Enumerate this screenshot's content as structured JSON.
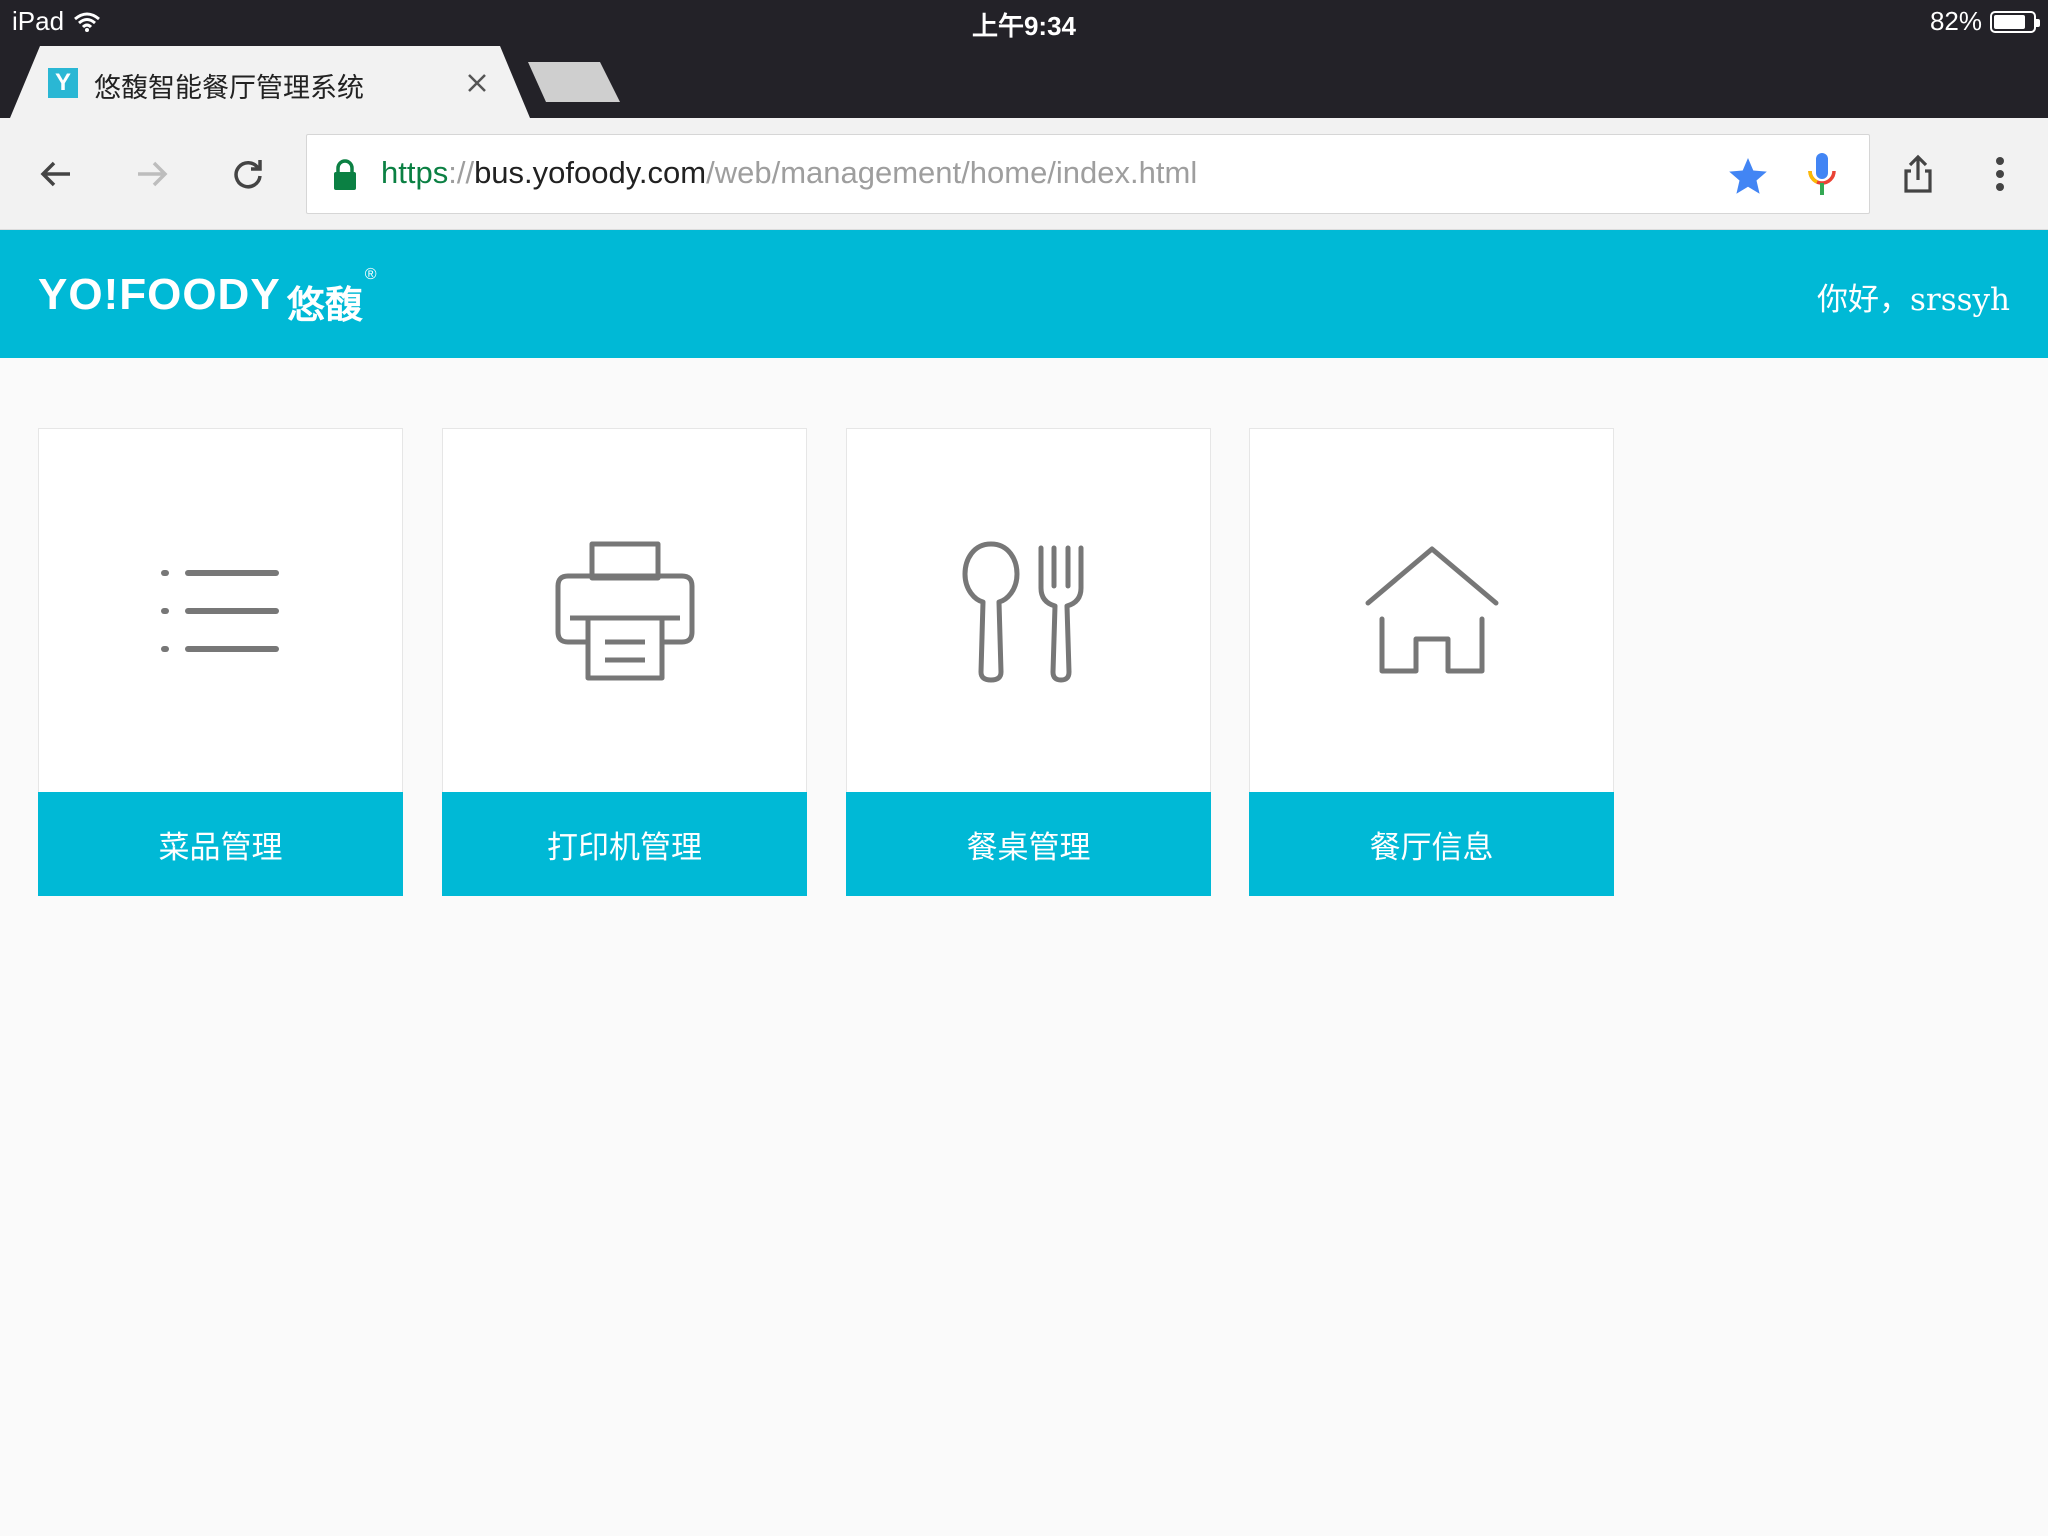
{
  "status_bar": {
    "device": "iPad",
    "time": "上午9:34",
    "battery": "82%",
    "battery_level": 0.82
  },
  "browser": {
    "tab_title": "悠馥智能餐厅管理系统",
    "favicon_letter": "Y",
    "url": {
      "scheme": "https",
      "separator": "://",
      "host": "bus.yofoody.com",
      "path": "/web/management/home/index.html"
    }
  },
  "header": {
    "logo_en": "YO!FOODY",
    "logo_cn": "悠馥",
    "logo_reg": "®",
    "greeting": "你好，srssyh"
  },
  "cards": [
    {
      "label": "菜品管理",
      "icon": "list-icon"
    },
    {
      "label": "打印机管理",
      "icon": "printer-icon"
    },
    {
      "label": "餐桌管理",
      "icon": "utensils-icon"
    },
    {
      "label": "餐厅信息",
      "icon": "home-icon"
    }
  ],
  "colors": {
    "brand": "#00b9d6",
    "status_bar": "#232228",
    "icon_gray": "#777777"
  }
}
